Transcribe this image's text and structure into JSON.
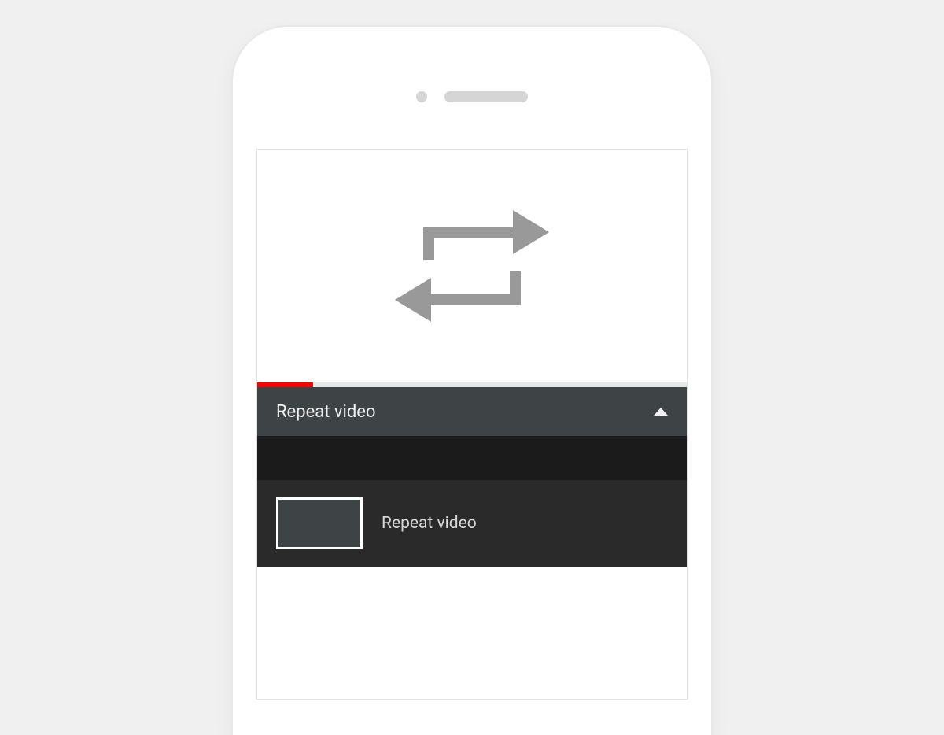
{
  "video": {
    "progress_percent": 13
  },
  "header": {
    "title": "Repeat video"
  },
  "playlist": {
    "items": [
      {
        "title": "Repeat video"
      }
    ]
  },
  "colors": {
    "accent": "#ff0000",
    "header_bg": "#3e4346",
    "dark_bg": "#1b1b1b",
    "row_bg": "#2a2a2a"
  }
}
